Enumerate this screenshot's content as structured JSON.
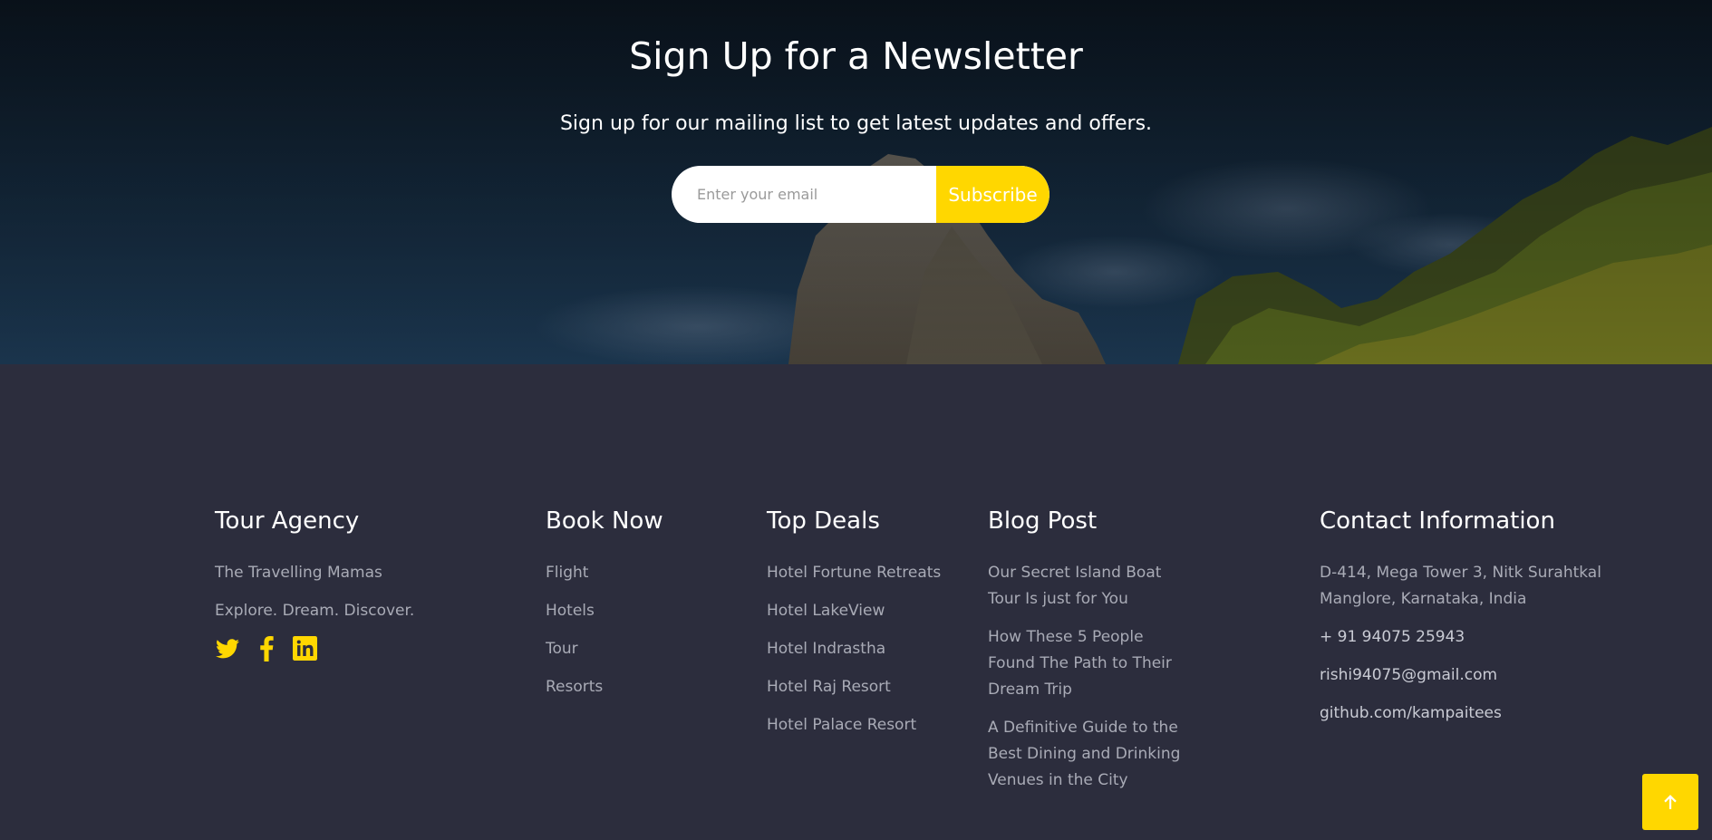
{
  "newsletter": {
    "title": "Sign Up for a Newsletter",
    "subtitle": "Sign up for our mailing list to get latest updates and offers.",
    "email_placeholder": "Enter your email",
    "subscribe_label": "Subscribe"
  },
  "footer": {
    "agency": {
      "heading": "Tour Agency",
      "name": "The Travelling Mamas",
      "tagline": "Explore. Dream. Discover.",
      "social": [
        "twitter-icon",
        "facebook-icon",
        "linkedin-icon"
      ]
    },
    "book_now": {
      "heading": "Book Now",
      "items": [
        "Flight",
        "Hotels",
        "Tour",
        "Resorts"
      ]
    },
    "top_deals": {
      "heading": "Top Deals",
      "items": [
        "Hotel Fortune Retreats",
        "Hotel LakeView",
        "Hotel Indrastha",
        "Hotel Raj Resort",
        "Hotel Palace Resort"
      ]
    },
    "blog_post": {
      "heading": "Blog Post",
      "items": [
        "Our Secret Island Boat Tour Is just for You",
        "How These 5 People Found The Path to Their Dream Trip",
        "A Definitive Guide to the Best Dining and Drinking Venues in the City"
      ]
    },
    "contact": {
      "heading": "Contact Information",
      "address": "D-414, Mega Tower 3, Nitk Surahtkal Manglore, Karnataka, India",
      "phone": "+ 91 94075 25943",
      "email": "rishi94075@gmail.com",
      "github": "github.com/kampaitees"
    }
  },
  "colors": {
    "accent": "#ffd700",
    "footer_bg": "#2c2d3d",
    "heading": "#ffffff",
    "link": "#a9abb6"
  },
  "back_to_top_icon": "arrow-up-icon"
}
